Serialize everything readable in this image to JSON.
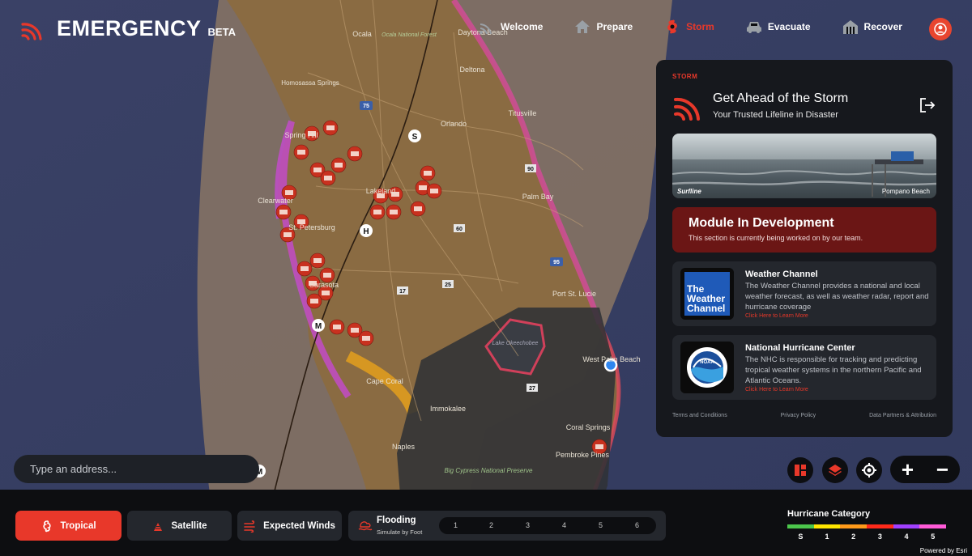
{
  "brand": {
    "name": "EMERGENCY",
    "tag": "BETA"
  },
  "nav": [
    {
      "label": "Welcome",
      "icon": "radar-icon",
      "active": false
    },
    {
      "label": "Prepare",
      "icon": "home-icon",
      "active": false
    },
    {
      "label": "Storm",
      "icon": "hurricane-icon",
      "active": true
    },
    {
      "label": "Evacuate",
      "icon": "car-icon",
      "active": false
    },
    {
      "label": "Recover",
      "icon": "rebuild-icon",
      "active": false
    }
  ],
  "panel": {
    "eyebrow": "STORM",
    "title": "Get Ahead of the Storm",
    "subtitle": "Your Trusted Lifeline in Disaster",
    "camera": {
      "brand": "Surfline",
      "location": "Pompano Beach"
    },
    "dev": {
      "title": "Module In Development",
      "text": "This section is currently being worked on by our team."
    },
    "cards": [
      {
        "title": "Weather Channel",
        "logo": {
          "line1": "The",
          "line2": "Weather",
          "line3": "Channel"
        },
        "text": "The Weather Channel provides a national and local weather forecast, as well as weather radar, report and hurricane coverage",
        "link": "Click Here to Learn More"
      },
      {
        "title": "National Hurricane Center",
        "logo": {
          "text": "NOAA"
        },
        "text": "The NHC is responsible for tracking and predicting tropical weather systems in the northern Pacific and Atlantic Oceans.",
        "link": "Click Here to Learn More"
      }
    ],
    "footer": [
      "Terms and Conditions",
      "Privacy Policy",
      "Data Partners & Attribution"
    ]
  },
  "search": {
    "placeholder": "Type an address..."
  },
  "map": {
    "labels": [
      "Ocala",
      "Ocala National Forest",
      "Daytona Beach",
      "Deltona",
      "Homosassa Springs",
      "Orlando",
      "Titusville",
      "Spring Hill",
      "Clearwater",
      "St. Petersburg",
      "Lakeland",
      "Palm Bay",
      "Port St. Lucie",
      "Lake Okeechobee",
      "Sarasota",
      "Cape Coral",
      "West Palm Beach",
      "Immokalee",
      "Coral Springs",
      "Naples",
      "Pembroke Pines",
      "Big Cypress National Preserve"
    ],
    "track_markers": [
      "S",
      "H",
      "M",
      "M"
    ],
    "road_shields": [
      "75",
      "95",
      "60",
      "17",
      "25",
      "27",
      "90"
    ]
  },
  "bottom": {
    "layers": [
      {
        "label": "Tropical",
        "icon": "tropical-storm-icon",
        "active": true
      },
      {
        "label": "Satellite",
        "icon": "satellite-icon",
        "active": false
      },
      {
        "label": "Expected Winds",
        "icon": "wind-icon",
        "active": false
      }
    ],
    "flooding": {
      "label": "Flooding",
      "sub": "Simulate by Foot",
      "steps": [
        "1",
        "2",
        "3",
        "4",
        "5",
        "6"
      ]
    },
    "legend": {
      "title": "Hurricane Category",
      "labels": [
        "S",
        "1",
        "2",
        "3",
        "4",
        "5"
      ],
      "colors": [
        "#4cc64c",
        "#ffe600",
        "#ff9a1a",
        "#ff2a1a",
        "#a040ff",
        "#ff5ad8"
      ]
    },
    "powered": "Powered by Esri"
  },
  "colors": {
    "accent": "#e8382a",
    "panel": "#16181d",
    "dev": "#6b1615"
  }
}
